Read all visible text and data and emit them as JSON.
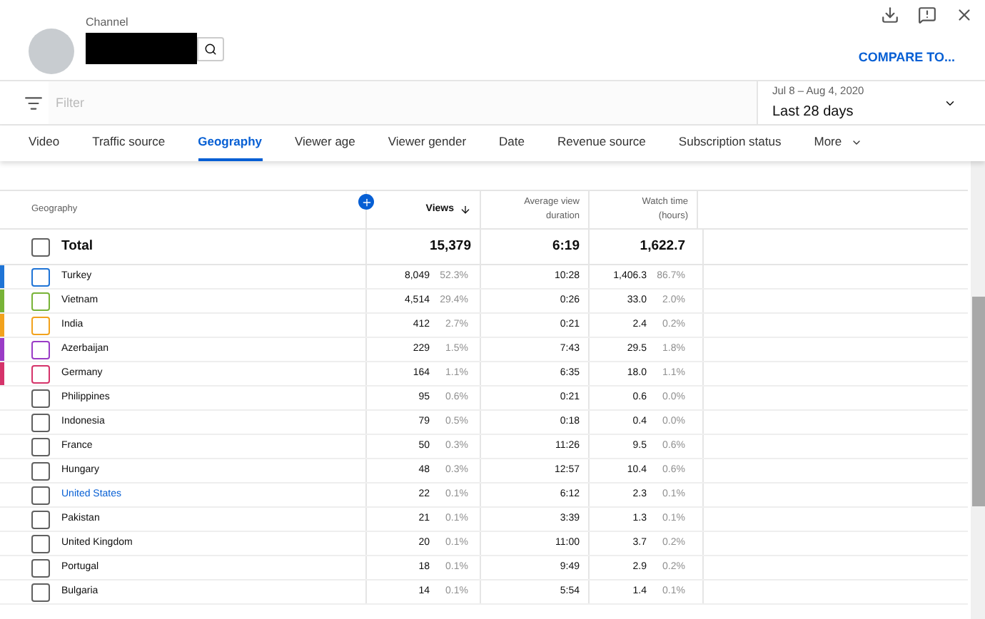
{
  "header": {
    "channel_label": "Channel",
    "compare_button": "COMPARE TO..."
  },
  "filter": {
    "placeholder": "Filter"
  },
  "date_range": {
    "range": "Jul 8 – Aug 4, 2020",
    "label": "Last 28 days"
  },
  "tabs": [
    {
      "label": "Video",
      "selected": false
    },
    {
      "label": "Traffic source",
      "selected": false
    },
    {
      "label": "Geography",
      "selected": true
    },
    {
      "label": "Viewer age",
      "selected": false
    },
    {
      "label": "Viewer gender",
      "selected": false
    },
    {
      "label": "Date",
      "selected": false
    },
    {
      "label": "Revenue source",
      "selected": false
    },
    {
      "label": "Subscription status",
      "selected": false
    },
    {
      "label": "More",
      "selected": false
    }
  ],
  "table": {
    "columns": [
      {
        "label": "Geography"
      },
      {
        "label": "Views",
        "sorted": true
      },
      {
        "label": "Average view duration",
        "sorted": false
      },
      {
        "label": "Watch time (hours)",
        "sorted": false
      }
    ],
    "total": {
      "label": "Total",
      "checked": false,
      "views": "15,379",
      "duration": "6:19",
      "watch_time": "1,622.7"
    },
    "rows": [
      {
        "name": "Turkey",
        "color": "#1f74d6",
        "checked": false,
        "link": false,
        "views": "8,049",
        "views_pct": "52.3%",
        "duration": "10:28",
        "watch_time": "1,406.3",
        "watch_pct": "86.7%"
      },
      {
        "name": "Vietnam",
        "color": "#78b337",
        "checked": false,
        "link": false,
        "views": "4,514",
        "views_pct": "29.4%",
        "duration": "0:26",
        "watch_time": "33.0",
        "watch_pct": "2.0%"
      },
      {
        "name": "India",
        "color": "#f2a21d",
        "checked": false,
        "link": false,
        "views": "412",
        "views_pct": "2.7%",
        "duration": "0:21",
        "watch_time": "2.4",
        "watch_pct": "0.2%"
      },
      {
        "name": "Azerbaijan",
        "color": "#9a3cc6",
        "checked": false,
        "link": false,
        "views": "229",
        "views_pct": "1.5%",
        "duration": "7:43",
        "watch_time": "29.5",
        "watch_pct": "1.8%"
      },
      {
        "name": "Germany",
        "color": "#d5336a",
        "checked": false,
        "link": false,
        "views": "164",
        "views_pct": "1.1%",
        "duration": "6:35",
        "watch_time": "18.0",
        "watch_pct": "1.1%"
      },
      {
        "name": "Philippines",
        "checked": false,
        "link": false,
        "views": "95",
        "views_pct": "0.6%",
        "duration": "0:21",
        "watch_time": "0.6",
        "watch_pct": "0.0%"
      },
      {
        "name": "Indonesia",
        "checked": false,
        "link": false,
        "views": "79",
        "views_pct": "0.5%",
        "duration": "0:18",
        "watch_time": "0.4",
        "watch_pct": "0.0%"
      },
      {
        "name": "France",
        "checked": false,
        "link": false,
        "views": "50",
        "views_pct": "0.3%",
        "duration": "11:26",
        "watch_time": "9.5",
        "watch_pct": "0.6%"
      },
      {
        "name": "Hungary",
        "checked": false,
        "link": false,
        "views": "48",
        "views_pct": "0.3%",
        "duration": "12:57",
        "watch_time": "10.4",
        "watch_pct": "0.6%"
      },
      {
        "name": "United States",
        "checked": false,
        "link": true,
        "views": "22",
        "views_pct": "0.1%",
        "duration": "6:12",
        "watch_time": "2.3",
        "watch_pct": "0.1%"
      },
      {
        "name": "Pakistan",
        "checked": false,
        "link": false,
        "views": "21",
        "views_pct": "0.1%",
        "duration": "3:39",
        "watch_time": "1.3",
        "watch_pct": "0.1%"
      },
      {
        "name": "United Kingdom",
        "checked": false,
        "link": false,
        "views": "20",
        "views_pct": "0.1%",
        "duration": "11:00",
        "watch_time": "3.7",
        "watch_pct": "0.2%"
      },
      {
        "name": "Portugal",
        "checked": false,
        "link": false,
        "views": "18",
        "views_pct": "0.1%",
        "duration": "9:49",
        "watch_time": "2.9",
        "watch_pct": "0.2%"
      },
      {
        "name": "Bulgaria",
        "checked": false,
        "link": false,
        "views": "14",
        "views_pct": "0.1%",
        "duration": "5:54",
        "watch_time": "1.4",
        "watch_pct": "0.1%"
      }
    ]
  }
}
